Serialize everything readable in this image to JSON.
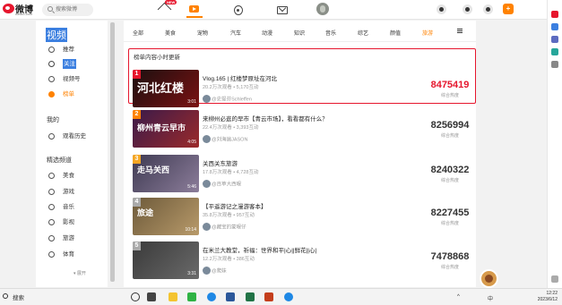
{
  "header": {
    "brand": "微博",
    "domain": "weibo.com",
    "search_placeholder": "搜索微博",
    "home_badge": "NEW",
    "compose_label": "+"
  },
  "sidebar": {
    "title": "视频",
    "items": [
      {
        "label": "推荐",
        "icon": "recommend-icon"
      },
      {
        "label": "关注",
        "icon": "follow-icon"
      },
      {
        "label": "视频号",
        "icon": "channel-icon"
      },
      {
        "label": "榜单",
        "icon": "trophy-icon"
      }
    ],
    "mine_heading": "我的",
    "mine_items": [
      {
        "label": "观看历史",
        "icon": "history-icon"
      }
    ],
    "channels_heading": "精选频道",
    "channels": [
      {
        "label": "美食",
        "icon": "food-icon"
      },
      {
        "label": "游戏",
        "icon": "game-icon"
      },
      {
        "label": "音乐",
        "icon": "music-icon"
      },
      {
        "label": "影视",
        "icon": "film-icon"
      },
      {
        "label": "旅游",
        "icon": "travel-icon"
      },
      {
        "label": "体育",
        "icon": "sports-icon"
      }
    ],
    "more": "▾ 展开"
  },
  "categories": [
    "全部",
    "美食",
    "宠物",
    "汽车",
    "动漫",
    "知识",
    "音乐",
    "综艺",
    "颜值",
    "旅游"
  ],
  "active_category": "旅游",
  "rank": {
    "title": "榜单内容小时更新",
    "items": [
      {
        "rank": "1",
        "title": "Vlog.165 | 红楼梦原址在河北",
        "stats": "20.2万次观看 • 5,170互动",
        "author": "@史提芬Schleffen",
        "hot": "8475419",
        "hot_label": "综合热度",
        "duration": "3:01",
        "caption": "河北红楼",
        "colors": [
          "#1b0f10",
          "#7a1212"
        ]
      },
      {
        "rank": "2",
        "title": "来柳州必逛的早市【青云市场】，看看都有什么？",
        "stats": "22.4万次观看 • 3,393互动",
        "author": "@刘海遍JASON",
        "hot": "8256994",
        "hot_label": "综合热度",
        "duration": "4:05",
        "caption": "柳州青云早市",
        "colors": [
          "#3a1a4a",
          "#9b2a2a"
        ]
      },
      {
        "rank": "3",
        "title": "关西关东旅游",
        "stats": "17.8万次观看 • 4,728互动",
        "author": "@百草大西眼",
        "hot": "8240322",
        "hot_label": "综合热度",
        "duration": "5:46",
        "caption": "走马关西",
        "colors": [
          "#3e3a52",
          "#8c7d9a"
        ]
      },
      {
        "rank": "4",
        "title": "【平遥游记之漫游客本】",
        "stats": "35.8万次观看 • 957互动",
        "author": "@藏宝的蒙眼仔",
        "hot": "8227455",
        "hot_label": "综合热度",
        "duration": "10:14",
        "caption": "旅途",
        "colors": [
          "#6d5a3a",
          "#b89a6a"
        ]
      },
      {
        "rank": "5",
        "title": "在米兰大教堂，祈福：世界和平|心||鲜花||心|",
        "stats": "12.2万次观看 • 386互动",
        "author": "@爬妹",
        "hot": "7478868",
        "hot_label": "综合热度",
        "duration": "3:31",
        "caption": "",
        "colors": [
          "#3a3a3a",
          "#6a6a6a"
        ]
      }
    ]
  },
  "taskbar": {
    "search": "搜索",
    "time": "12:22",
    "date": "2023/6/12",
    "lang": "中"
  }
}
